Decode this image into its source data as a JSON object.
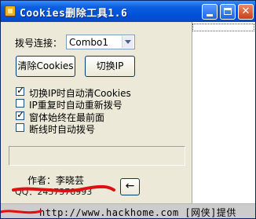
{
  "window": {
    "title": "Cookies删除工具1.6",
    "icon": "app-icon"
  },
  "main": {
    "dial_label": "拨号连接：",
    "dial_select": {
      "value": "Combo1"
    },
    "clear_cookies_button": "清除Cookies",
    "switch_ip_button": "切换IP",
    "options": [
      {
        "label": "切换IP时自动清Cookies",
        "checked": true
      },
      {
        "label": "IP重复时自动重新拨号",
        "checked": false
      },
      {
        "label": "窗体始终在最前面",
        "checked": true
      },
      {
        "label": "断线时自动拨号",
        "checked": false
      }
    ],
    "author_label": "作者：李晓芸",
    "contact_text": "QQ：2437378993",
    "back_button": "←"
  },
  "footer": {
    "text": "http://www.hackhome.com [网侠]提供"
  },
  "colors": {
    "titlebar": "#0050d8",
    "redline": "#e01010"
  }
}
